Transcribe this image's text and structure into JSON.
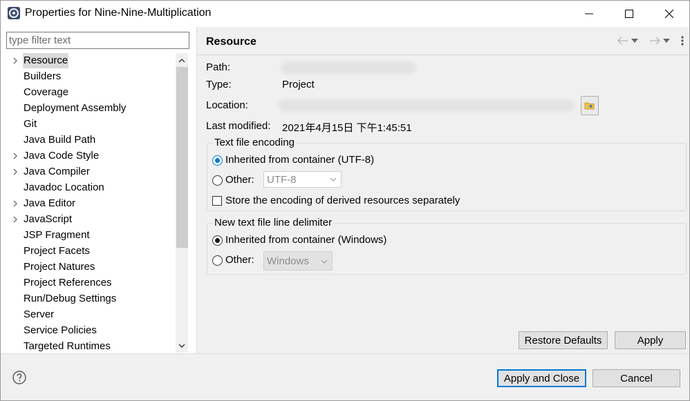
{
  "window": {
    "title": "Properties for Nine-Nine-Multiplication",
    "controls": [
      "minimize-icon",
      "maximize-icon",
      "close-icon"
    ]
  },
  "left": {
    "filter_placeholder": "type filter text",
    "items": [
      {
        "label": "Resource",
        "expandable": true,
        "selected": true
      },
      {
        "label": "Builders",
        "expandable": false
      },
      {
        "label": "Coverage",
        "expandable": false
      },
      {
        "label": "Deployment Assembly",
        "expandable": false
      },
      {
        "label": "Git",
        "expandable": false
      },
      {
        "label": "Java Build Path",
        "expandable": false
      },
      {
        "label": "Java Code Style",
        "expandable": true
      },
      {
        "label": "Java Compiler",
        "expandable": true
      },
      {
        "label": "Javadoc Location",
        "expandable": false
      },
      {
        "label": "Java Editor",
        "expandable": true
      },
      {
        "label": "JavaScript",
        "expandable": true
      },
      {
        "label": "JSP Fragment",
        "expandable": false
      },
      {
        "label": "Project Facets",
        "expandable": false
      },
      {
        "label": "Project Natures",
        "expandable": false
      },
      {
        "label": "Project References",
        "expandable": false
      },
      {
        "label": "Run/Debug Settings",
        "expandable": false
      },
      {
        "label": "Server",
        "expandable": false
      },
      {
        "label": "Service Policies",
        "expandable": false
      },
      {
        "label": "Targeted Runtimes",
        "expandable": false
      }
    ]
  },
  "right": {
    "title": "Resource",
    "path_label": "Path:",
    "type_label": "Type:",
    "type_value": "Project",
    "location_label": "Location:",
    "modified_label": "Last modified:",
    "modified_value": "2021年4月15日 下午1:45:51",
    "encoding_group": {
      "title": "Text file encoding",
      "inherited": "Inherited from container (UTF-8)",
      "other": "Other:",
      "other_value": "UTF-8",
      "store_derived": "Store the encoding of derived resources separately"
    },
    "delimiter_group": {
      "title": "New text file line delimiter",
      "inherited": "Inherited from container (Windows)",
      "other": "Other:",
      "other_value": "Windows"
    },
    "restore_defaults": "Restore Defaults",
    "apply": "Apply"
  },
  "bottom": {
    "apply_and_close": "Apply and Close",
    "cancel": "Cancel"
  },
  "colors": {
    "accent": "#0078d7",
    "panel_bg": "#f0f0f0",
    "selection_bg": "#d9d9d9"
  }
}
